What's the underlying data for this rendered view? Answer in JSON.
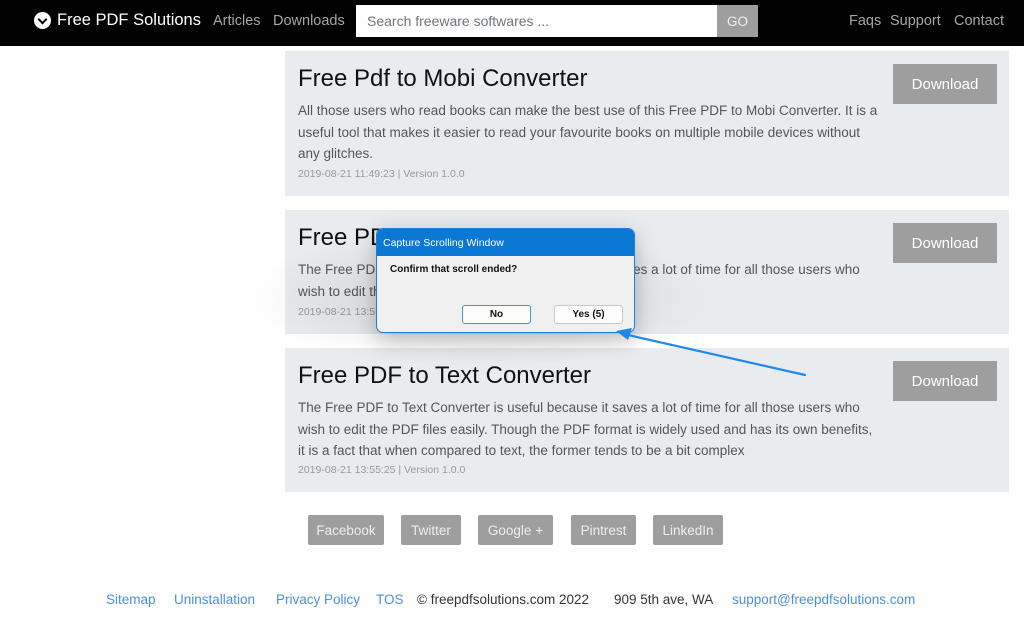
{
  "header": {
    "brand": "Free PDF Solutions",
    "brand_icon": "chevron-circle-down-icon",
    "nav_left": [
      "Articles",
      "Downloads"
    ],
    "search": {
      "placeholder": "Search freeware softwares ...",
      "value": "",
      "button": "GO"
    },
    "nav_right": [
      "Faqs",
      "Support",
      "Contact"
    ]
  },
  "cards": [
    {
      "title": "Free Pdf to Mobi Converter",
      "description": "All those users who read books can make the best use of this Free PDF to Mobi Converter. It is a useful tool that makes it easier to read your favourite books on multiple mobile devices without any glitches.",
      "meta": "2019-08-21 11:49:23 | Version 1.0.0",
      "button": "Download"
    },
    {
      "title": "Free PDF to Text Converter",
      "description": "The Free PDF to Text Converter is useful because it saves a lot of time for all those users who wish to edit the PDF files easily.",
      "meta": "2019-08-21 13:55:25 | Version 1.0.0",
      "button": "Download"
    },
    {
      "title": "Free PDF to Text Converter",
      "description": "The Free PDF to Text Converter is useful because it saves a lot of time for all those users who wish to edit the PDF files easily. Though the PDF format is widely used and has its own benefits, it is a fact that when compared to text, the former tends to be a bit complex",
      "meta": "2019-08-21 13:55:25 | Version 1.0.0",
      "button": "Download"
    }
  ],
  "social": [
    "Facebook",
    "Twitter",
    "Google +",
    "Pintrest",
    "LinkedIn"
  ],
  "footer": {
    "links": [
      "Sitemap",
      "Uninstallation",
      "Privacy Policy",
      "TOS"
    ],
    "copyright": "© freepdfsolutions.com 2022",
    "address": "909 5th ave, WA",
    "email": "support@freepdfsolutions.com"
  },
  "dialog": {
    "title": "Capture Scrolling Window",
    "message": "Confirm that scroll ended?",
    "no_label": "No",
    "yes_label": "Yes (5)"
  },
  "colors": {
    "navbar": "#000000",
    "card_bg": "#e9ecef",
    "button_gray": "#9e9e9e",
    "link_blue": "#4d8fd6",
    "dialog_title": "#0a78d4",
    "annotation_arrow": "#1e88f0"
  }
}
